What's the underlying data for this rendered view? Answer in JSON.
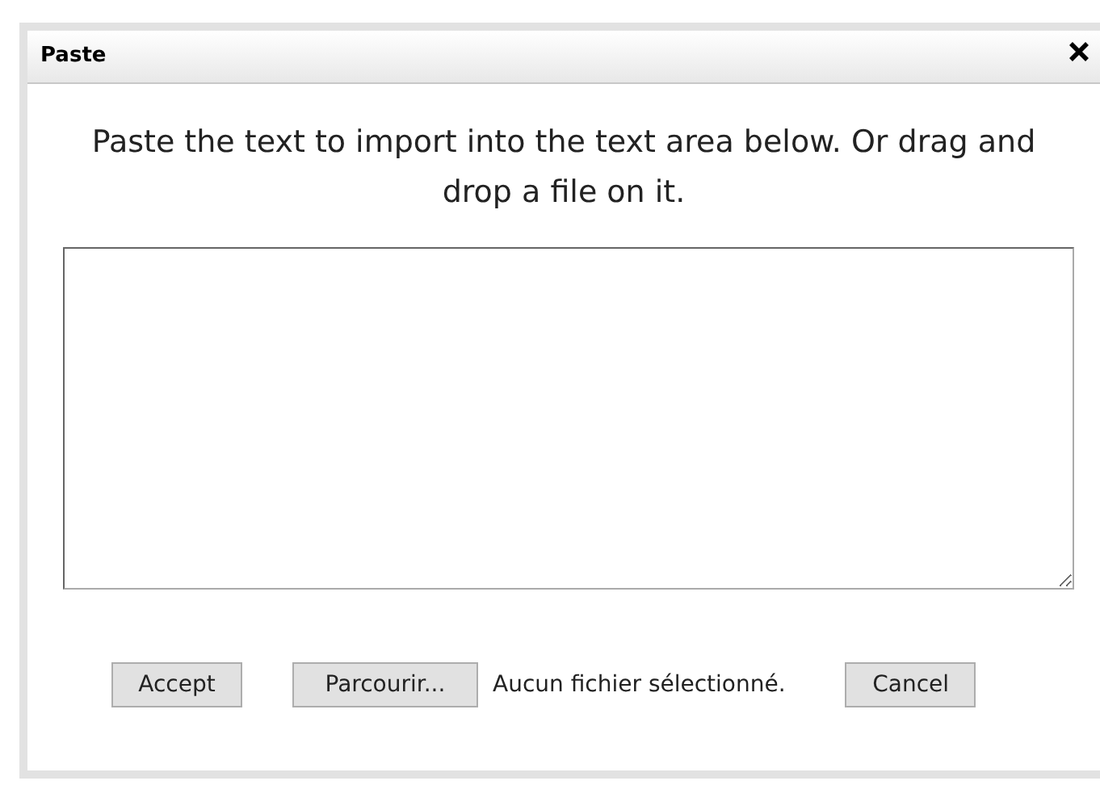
{
  "dialog": {
    "title": "Paste",
    "instruction": "Paste the text to import into the text area below. Or drag and drop a file on it.",
    "accept_button": "Accept",
    "browse_button": "Parcourir...",
    "file_status": "Aucun fichier sélectionné.",
    "cancel_button": "Cancel"
  }
}
